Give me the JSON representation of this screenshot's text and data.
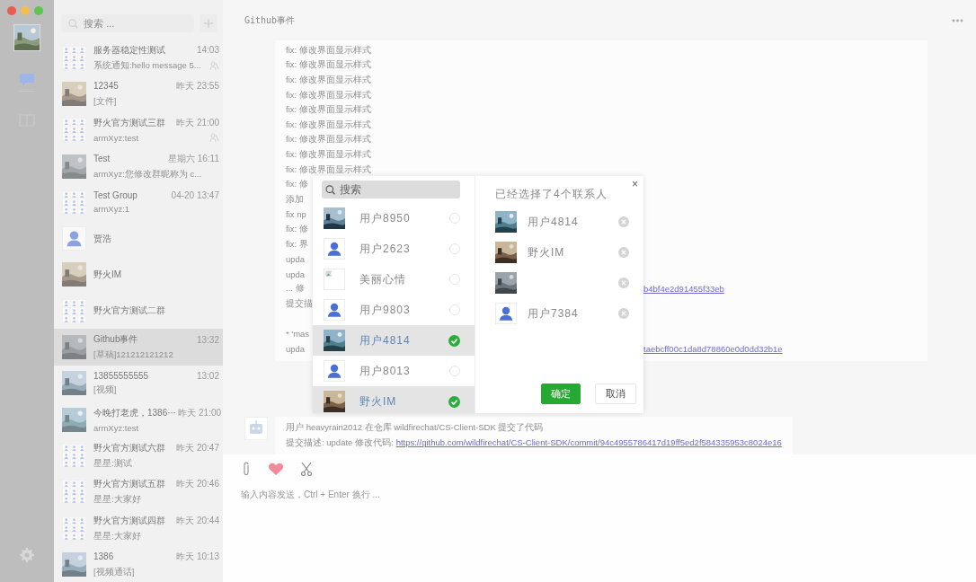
{
  "rail": {
    "items": [
      {
        "kind": "chat",
        "selected": true
      },
      {
        "kind": "contacts",
        "selected": false
      }
    ]
  },
  "sidebar": {
    "search": {
      "placeholder": "搜索 ..."
    },
    "conversations": [
      {
        "name": "服务器稳定性测试",
        "time": "14:03",
        "preview": "系统通知:hello message 5...",
        "kind": "grid",
        "muted": true,
        "selected": false
      },
      {
        "name": "12345",
        "time": "昨天 23:55",
        "preview": "[文件]",
        "kind": "picture",
        "muted": false,
        "selected": false
      },
      {
        "name": "野火官方测试三群",
        "time": "昨天 21:00",
        "preview": "armXyz:test",
        "kind": "grid",
        "muted": true,
        "selected": false
      },
      {
        "name": "Test",
        "time": "星期六 16:11",
        "preview": "armXyz:您修改群昵称为 c...",
        "kind": "picture",
        "muted": false,
        "selected": false
      },
      {
        "name": "Test Group",
        "time": "04-20 13:47",
        "preview": "armXyz:1",
        "kind": "grid",
        "muted": false,
        "selected": false
      },
      {
        "name": "贾浩",
        "kind": "person",
        "muted": false,
        "selected": false
      },
      {
        "name": "野火IM",
        "kind": "picture",
        "muted": false,
        "selected": false
      },
      {
        "name": "野火官方测试二群",
        "kind": "grid",
        "muted": false,
        "selected": false
      },
      {
        "name": "Github事件",
        "time": "13:32",
        "preview": "[草稿]121212121212",
        "kind": "picture",
        "muted": false,
        "selected": true
      },
      {
        "name": "13855555555",
        "time": "13:02",
        "preview": "[视频]",
        "kind": "picture",
        "muted": false,
        "selected": false
      },
      {
        "name": "今晚打老虎，1386⋯",
        "time": "昨天 21:00",
        "preview": "armXyz:test",
        "kind": "picture",
        "muted": false,
        "selected": false
      },
      {
        "name": "野火官方测试六群",
        "time": "昨天 20:47",
        "preview": "星星:测试",
        "kind": "grid",
        "muted": false,
        "selected": false
      },
      {
        "name": "野火官方测试五群",
        "time": "昨天 20:46",
        "preview": "星星:大家好",
        "kind": "grid",
        "muted": false,
        "selected": false
      },
      {
        "name": "野火官方测试四群",
        "time": "昨天 20:44",
        "preview": "星星:大家好",
        "kind": "grid",
        "muted": false,
        "selected": false
      },
      {
        "name": "1386",
        "time": "昨天 10:13",
        "preview": "[视频通话]",
        "kind": "picture",
        "muted": false,
        "selected": false
      }
    ]
  },
  "chat": {
    "title": "Github事件",
    "messages": [
      {
        "kind": "card",
        "lines": [
          {
            "text": "fix: 修改界面显示样式"
          },
          {
            "text": "fix: 修改界面显示样式"
          },
          {
            "text": "fix: 修改界面显示样式"
          },
          {
            "text": "fix: 修改界面显示样式"
          },
          {
            "text": "fix: 修改界面显示样式"
          },
          {
            "text": "fix: 修改界面显示样式"
          },
          {
            "text": "fix: 修改界面显示样式"
          },
          {
            "text": "fix: 修改界面显示样式"
          },
          {
            "text": "fix: 修改界面显示样式"
          },
          {
            "text": "fix: 修"
          },
          {
            "text": "添加"
          },
          {
            "text": "fix np"
          },
          {
            "text": "fix: 修"
          },
          {
            "text": "fix: 界"
          },
          {
            "text": "upda"
          },
          {
            "text": "upda"
          },
          {
            "text": "... 修",
            "link": "b4bf4e2d91455f33eb"
          },
          {
            "text": "提交描"
          },
          {
            "text": "* 'mas",
            "spaced": true
          },
          {
            "text": "upda",
            "link": "taebcff00c1da8d78860e0d0dd32b1e"
          }
        ]
      },
      {
        "kind": "robot",
        "lines": [
          {
            "text": "用户 heavyrain2012 在仓库 wildfirechat/CS-Client-SDK 提交了代码"
          },
          {
            "text": "提交描述: update 修改代码:",
            "link": "https://github.com/wildfirechat/CS-Client-SDK/commit/94c4955786417d19ff5ed2f584335953c8024e16"
          }
        ]
      }
    ]
  },
  "composer": {
    "placeholder": "输入内容发送，Ctrl + Enter 换行 ..."
  },
  "dialog": {
    "close": "×",
    "search": {
      "placeholder": "搜索"
    },
    "contacts": [
      {
        "name": "用户8950",
        "kind": "picture",
        "selected": false
      },
      {
        "name": "用户2623",
        "kind": "person",
        "selected": false
      },
      {
        "name": "美丽心情",
        "kind": "broken",
        "selected": false
      },
      {
        "name": "用户9803",
        "kind": "person",
        "selected": false
      },
      {
        "name": "用户4814",
        "kind": "picture",
        "selected": true
      },
      {
        "name": "用户8013",
        "kind": "person",
        "selected": false
      },
      {
        "name": "野火IM",
        "kind": "picture",
        "selected": true
      }
    ],
    "heading": "已经选择了4个联系人",
    "chosen": [
      {
        "name": "用户4814",
        "kind": "picture"
      },
      {
        "name": "野火IM",
        "kind": "picture"
      },
      {
        "kind": "picture"
      },
      {
        "name": "用户7384",
        "kind": "person"
      }
    ],
    "buttons": [
      {
        "label": "确定",
        "kind": "primary"
      },
      {
        "label": "取消",
        "kind": "secondary"
      }
    ]
  }
}
